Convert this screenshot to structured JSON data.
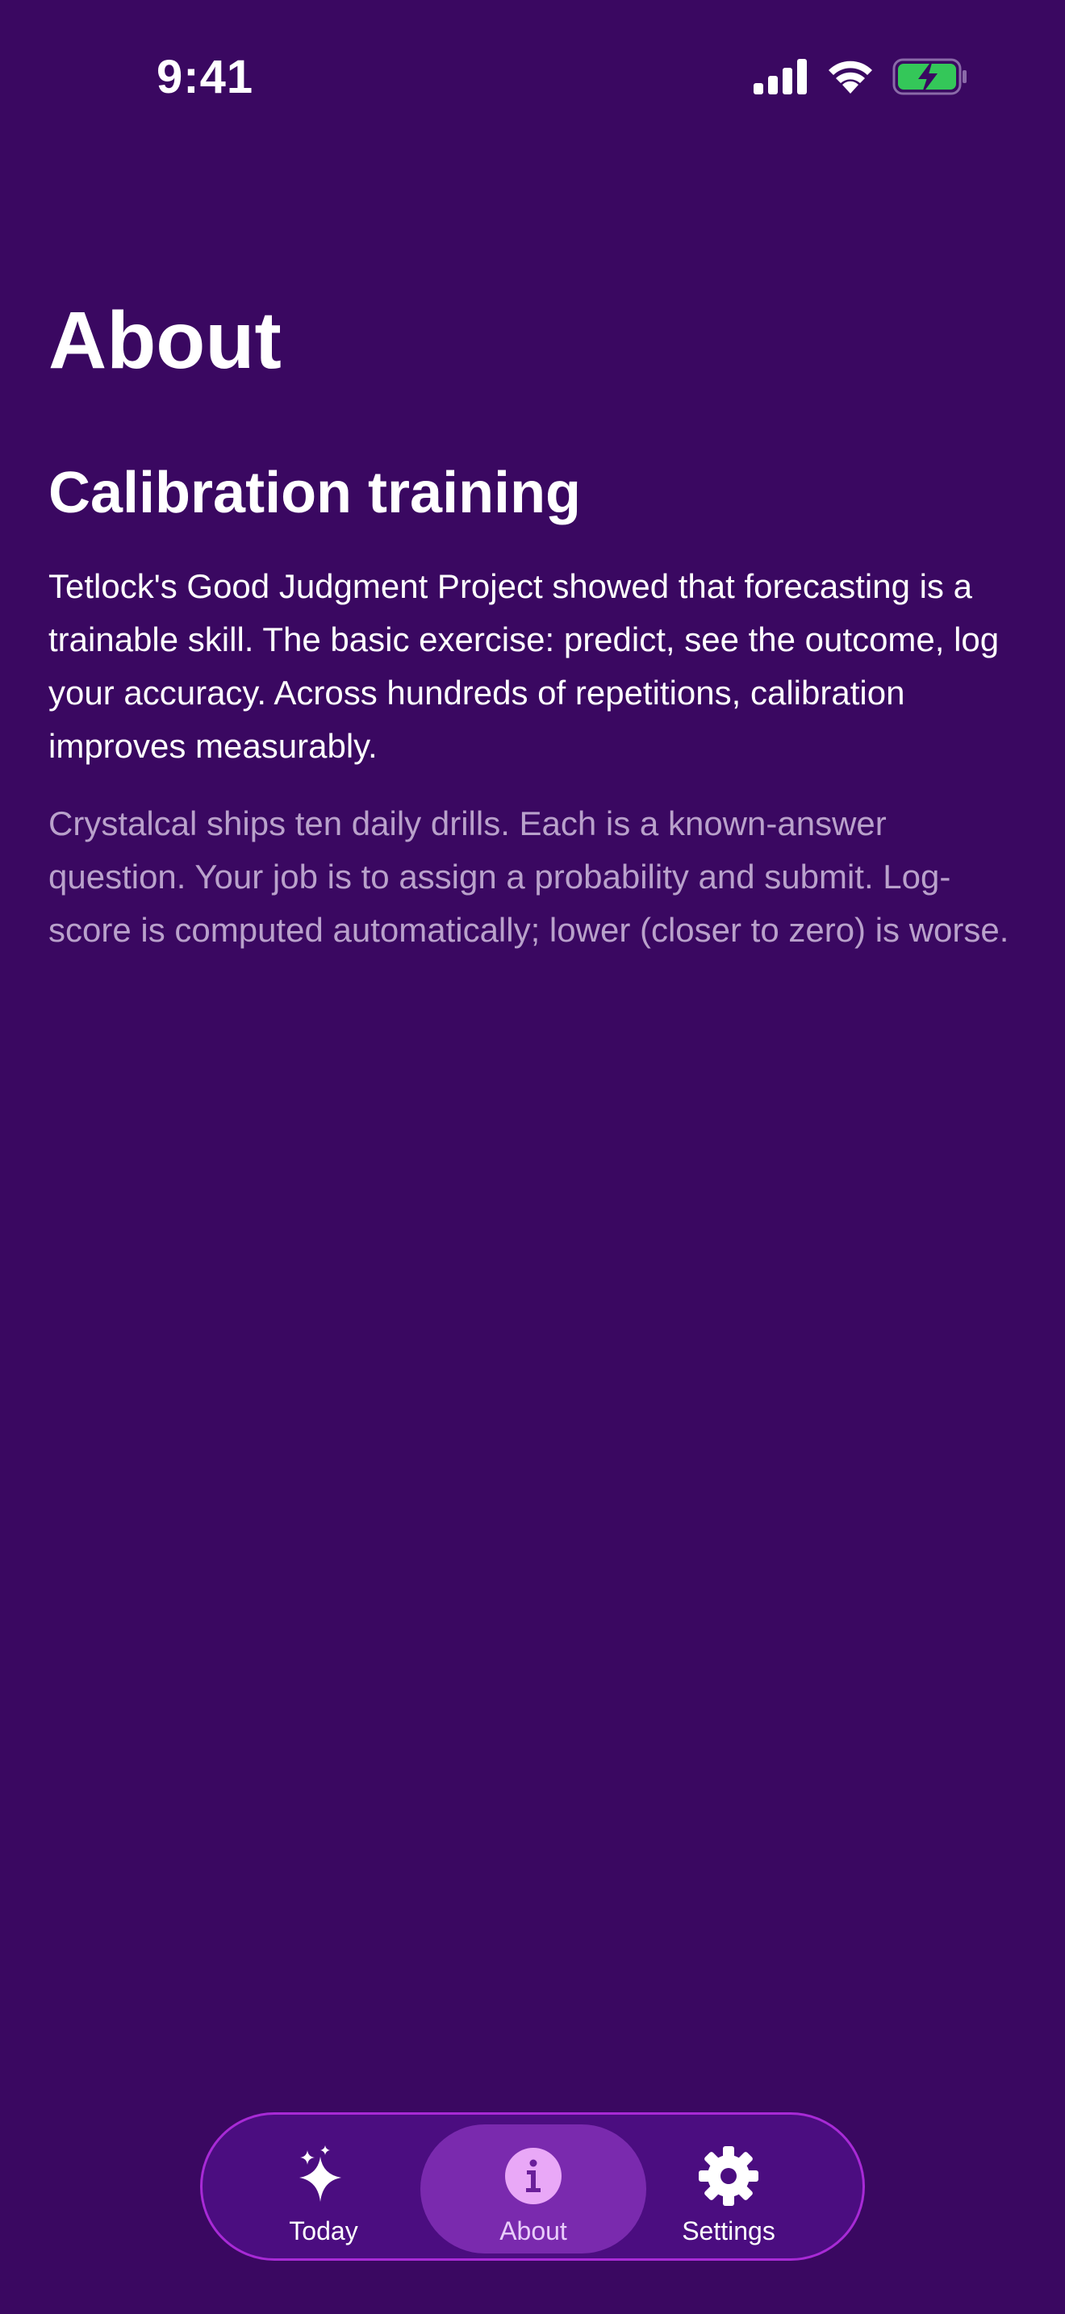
{
  "status_bar": {
    "time": "9:41"
  },
  "page": {
    "title": "About",
    "section_title": "Calibration training",
    "paragraph_1": "Tetlock's Good Judgment Project showed that forecasting is a trainable skill. The basic exercise: predict, see the outcome, log your accuracy. Across hundreds of repetitions, calibration improves measurably.",
    "paragraph_2": "Crystalcal ships ten daily drills. Each is a known-answer question. Your job is to assign a probability and submit. Log-score is computed automatically; lower (closer to zero) is worse."
  },
  "tab_bar": {
    "tabs": [
      {
        "label": "Today",
        "icon": "sparkles-icon",
        "selected": false
      },
      {
        "label": "About",
        "icon": "info-icon",
        "selected": true
      },
      {
        "label": "Settings",
        "icon": "gear-icon",
        "selected": false
      }
    ]
  },
  "colors": {
    "background": "#3a0861",
    "tab_bar_bg": "#4b0d80",
    "tab_bar_border": "#a82ad6",
    "selected_tab_bg": "#7a2aae",
    "secondary_text": "#b9a1cb",
    "battery_fill": "#34c759"
  }
}
